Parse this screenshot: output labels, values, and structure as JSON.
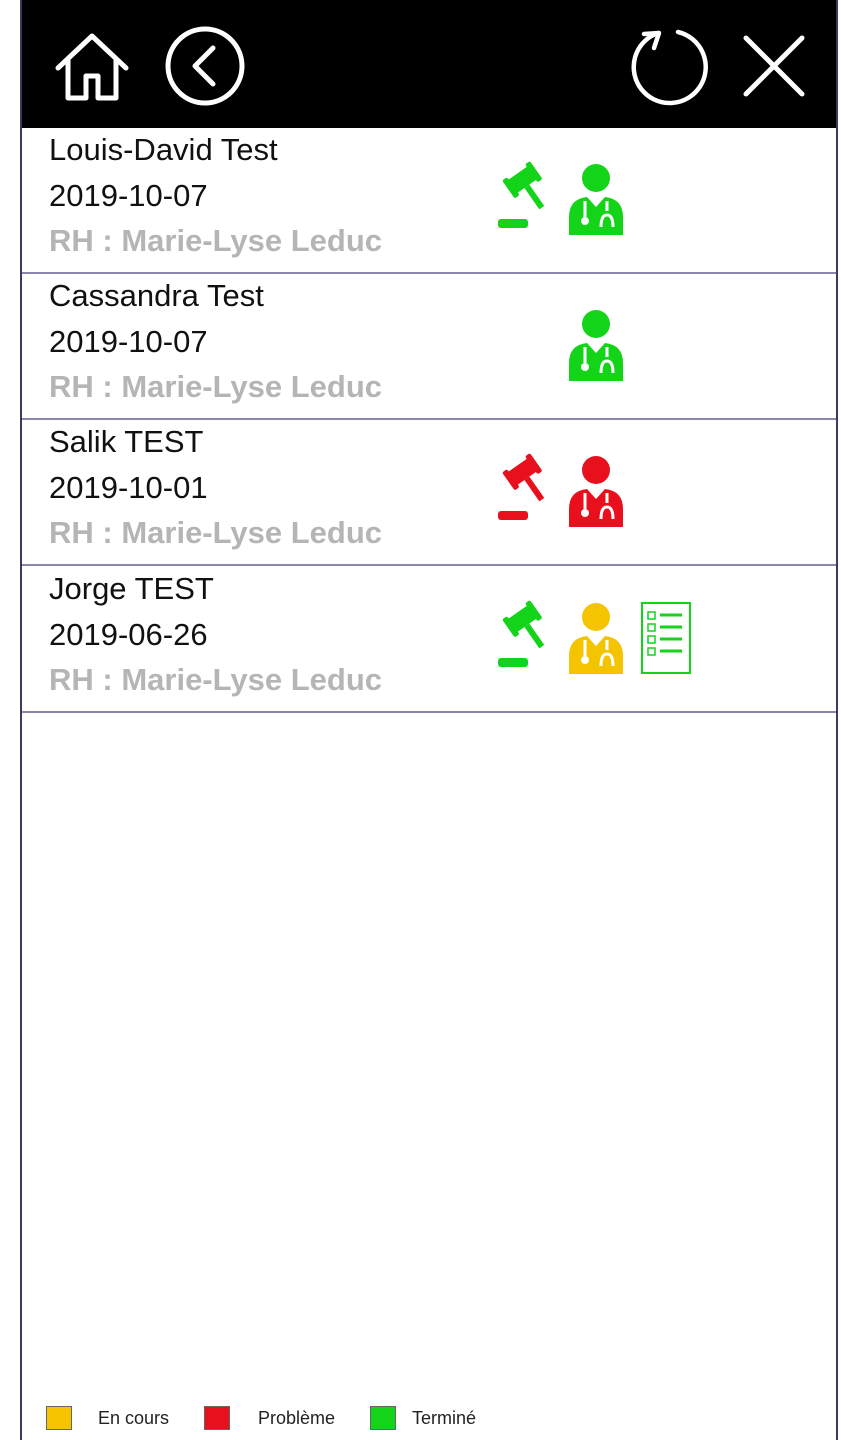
{
  "colors": {
    "en_cours": "#f4c400",
    "probleme": "#e8101c",
    "termine": "#14d41a"
  },
  "toolbar": {
    "home_icon": "home-icon",
    "back_icon": "back-circle-icon",
    "refresh_icon": "refresh-icon",
    "close_icon": "close-icon"
  },
  "rows": [
    {
      "name": "Louis-David Test",
      "date": "2019-10-07",
      "rh": "RH : Marie-Lyse Leduc",
      "icons": [
        {
          "icon": "gavel-icon",
          "status": "termine"
        },
        {
          "icon": "doctor-icon",
          "status": "termine"
        }
      ]
    },
    {
      "name": "Cassandra Test",
      "date": "2019-10-07",
      "rh": "RH : Marie-Lyse Leduc",
      "icons": [
        {
          "icon": "doctor-icon",
          "status": "termine"
        }
      ]
    },
    {
      "name": "Salik TEST",
      "date": "2019-10-01",
      "rh": "RH : Marie-Lyse Leduc",
      "icons": [
        {
          "icon": "gavel-icon",
          "status": "probleme"
        },
        {
          "icon": "doctor-icon",
          "status": "probleme"
        }
      ]
    },
    {
      "name": "Jorge TEST",
      "date": "2019-06-26",
      "rh": "RH : Marie-Lyse Leduc",
      "icons": [
        {
          "icon": "gavel-icon",
          "status": "termine"
        },
        {
          "icon": "doctor-icon",
          "status": "en_cours"
        },
        {
          "icon": "checklist-icon",
          "status": "termine"
        }
      ]
    }
  ],
  "legend": [
    {
      "label": "En cours",
      "status": "en_cours"
    },
    {
      "label": "Problème",
      "status": "probleme"
    },
    {
      "label": "Terminé",
      "status": "termine"
    }
  ]
}
